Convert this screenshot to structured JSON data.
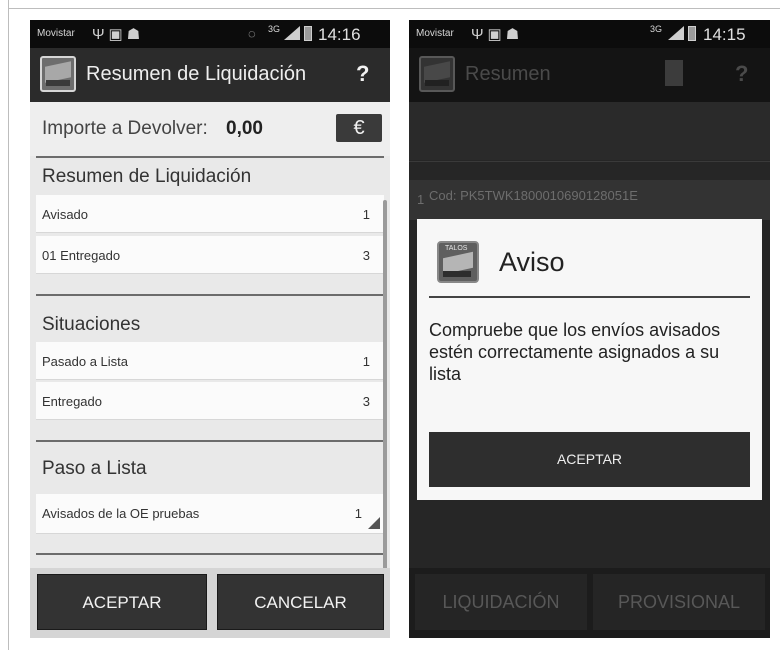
{
  "left_screen": {
    "status": {
      "carrier": "Movistar",
      "network": "3G",
      "time": "14:16"
    },
    "actionbar": {
      "title": "Resumen de Liquidación",
      "help": "?"
    },
    "amount": {
      "label": "Importe a Devolver:",
      "value": "0,00",
      "currency": "€"
    },
    "sections": {
      "resumen": {
        "title": "Resumen de Liquidación",
        "rows": [
          {
            "label": "Avisado",
            "count": "1"
          },
          {
            "label": "01 Entregado",
            "count": "3"
          }
        ]
      },
      "situaciones": {
        "title": "Situaciones",
        "rows": [
          {
            "label": "Pasado a Lista",
            "count": "1"
          },
          {
            "label": "Entregado",
            "count": "3"
          }
        ]
      },
      "paso_lista": {
        "title": "Paso a Lista",
        "rows": [
          {
            "label": "Avisados de la OE pruebas",
            "count": "1"
          }
        ]
      }
    },
    "buttons": {
      "accept": "ACEPTAR",
      "cancel": "CANCELAR"
    }
  },
  "right_screen": {
    "status": {
      "carrier": "Movistar",
      "network": "3G",
      "time": "14:15"
    },
    "actionbar": {
      "title": "Resumen",
      "help": "?"
    },
    "background_item": {
      "index": "1",
      "code": "Cod:  PK5TWK1800010690128051E"
    },
    "dialog": {
      "icon_label": "TALOS",
      "title": "Aviso",
      "message": "Compruebe que los envíos avisados estén correctamente asignados a su lista",
      "button": "ACEPTAR"
    },
    "buttons": {
      "liquidacion": "LIQUIDACIÓN",
      "provisional": "PROVISIONAL"
    }
  },
  "colors": {
    "status_bar": "#0c0c0c",
    "action_bar": "#2b2b2b",
    "button": "#333333",
    "dialog_bg": "#f7f7f7"
  },
  "icons": [
    "usb-icon",
    "image-icon",
    "android-icon",
    "sync-icon",
    "signal-icon",
    "battery-icon",
    "help-icon",
    "document-icon",
    "app-icon"
  ]
}
